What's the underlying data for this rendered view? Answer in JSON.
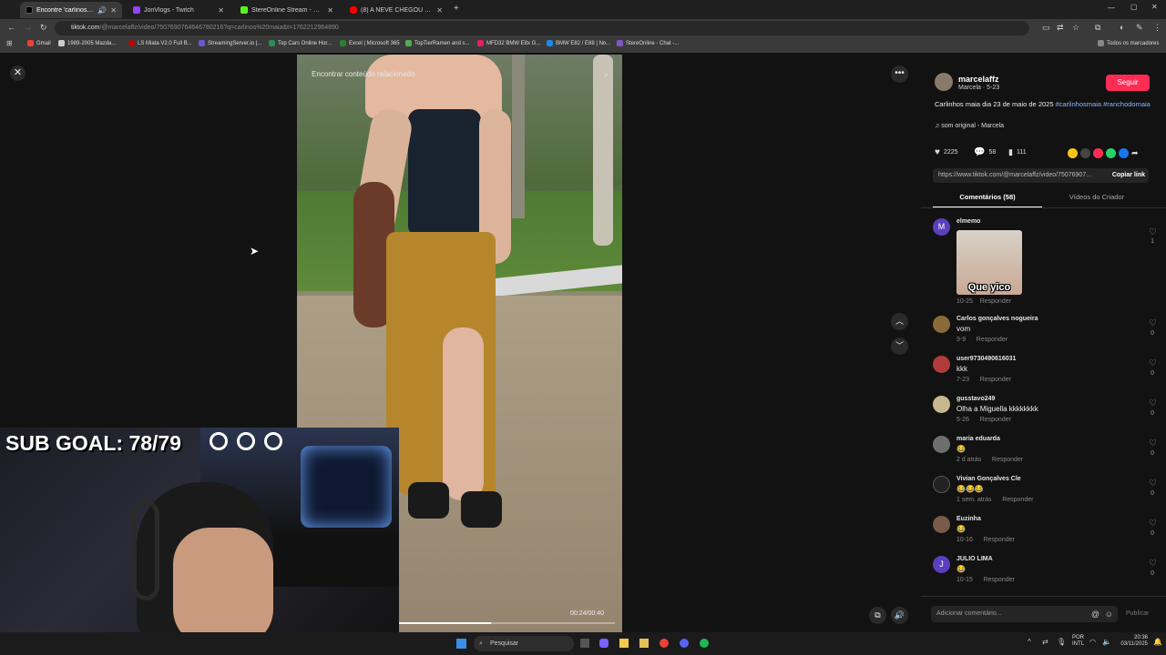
{
  "tabs": [
    {
      "title": "Encontre 'carlinos maia' no",
      "color": "#000000",
      "active": true
    },
    {
      "title": "JonVlogs - Twitch",
      "color": "#9146ff",
      "active": false
    },
    {
      "title": "StereOnline Stream - Watch Liv",
      "color": "#53fc18",
      "active": false
    },
    {
      "title": "(8) A NEVE CHEGOU CEDO ESSE",
      "color": "#ff0000",
      "active": false
    }
  ],
  "address": {
    "domain": "tiktok.com",
    "path": "/@marcelaffz/video/7507690764646780216?q=carlinos%20maia&t=1762212964890"
  },
  "bookmarks": [
    {
      "label": "Gmail",
      "color": "#ea4335"
    },
    {
      "label": "1989-2005 Mazda...",
      "color": "#cccccc"
    },
    {
      "label": "LS Miata V2.0 Full B...",
      "color": "#c40000"
    },
    {
      "label": "StreamingServer.io |...",
      "color": "#6a5acd"
    },
    {
      "label": "Top Cars Online Hor...",
      "color": "#2e8b57"
    },
    {
      "label": "Excel | Microsoft 365",
      "color": "#2e7d32"
    },
    {
      "label": "TopTierRamen and s...",
      "color": "#4caf50"
    },
    {
      "label": "MFD32 BMW E8x G...",
      "color": "#e91e63"
    },
    {
      "label": "BMW E82 / E88 | No...",
      "color": "#1e88e5"
    },
    {
      "label": "StereOnline - Chat -...",
      "color": "#7e57c2"
    }
  ],
  "bookmarks_all": "Todos os marcadores",
  "video": {
    "search_placeholder": "Encontrar conteúdo relacionado",
    "time": "00:24/00:40",
    "progress": 0.6
  },
  "overlay": {
    "sub_goal": "SUB GOAL: 78/79"
  },
  "post": {
    "username": "marcelaffz",
    "display": "Marcela · 5-23",
    "follow": "Seguir",
    "caption": "Carlinhos maia dia 23 de maio de 2025",
    "tag1": "#carlinhosmaia",
    "tag2": "#ranchodomaia",
    "sound": "som original - Marcela",
    "likes": "2225",
    "comments": "58",
    "saves": "111",
    "link": "https://www.tiktok.com/@marcelaffz/video/75076907...",
    "copy": "Copiar link",
    "tab_comments": "Comentários (58)",
    "tab_creator": "Vídeos do Criador"
  },
  "comments": [
    {
      "name": "elmemo",
      "text": "",
      "date": "10-25",
      "reply": "Responder",
      "likes": "1",
      "avatar": "#5b3fbf",
      "sticker": "Que yico"
    },
    {
      "name": "Carlos gonçalves nogueira",
      "text": "vom",
      "date": "9-9",
      "reply": "Responder",
      "likes": "0",
      "avatar": "#8a6a3a"
    },
    {
      "name": "user9730490616031",
      "text": "kkk",
      "date": "7-23",
      "reply": "Responder",
      "likes": "0",
      "avatar": "#b23b3b"
    },
    {
      "name": "gusstavo249",
      "text": "Olha a Miguella kkkkkkkk",
      "date": "5-26",
      "reply": "Responder",
      "likes": "0",
      "avatar": "#c8b890"
    },
    {
      "name": "maria eduarda",
      "text": "😂",
      "date": "2 d atrás",
      "reply": "Responder",
      "likes": "0",
      "avatar": "#6e6e6e"
    },
    {
      "name": "Vivian Gonçalves Cle",
      "text": "😂😂😂",
      "date": "1 sem. atrás",
      "reply": "Responder",
      "likes": "0",
      "avatar": "#222222"
    },
    {
      "name": "Euzinha",
      "text": "😂",
      "date": "10-16",
      "reply": "Responder",
      "likes": "0",
      "avatar": "#7a5a4a"
    },
    {
      "name": "JULIO LIMA",
      "text": "😂",
      "date": "10-15",
      "reply": "Responder",
      "likes": "0",
      "avatar": "#5b3fbf"
    }
  ],
  "comment_input": {
    "placeholder": "Adicionar comentário...",
    "publish": "Publicar"
  },
  "taskbar": {
    "search": "Pesquisar",
    "lang1": "POR",
    "lang2": "INTL",
    "time": "20:36",
    "date": "03/11/2025"
  }
}
